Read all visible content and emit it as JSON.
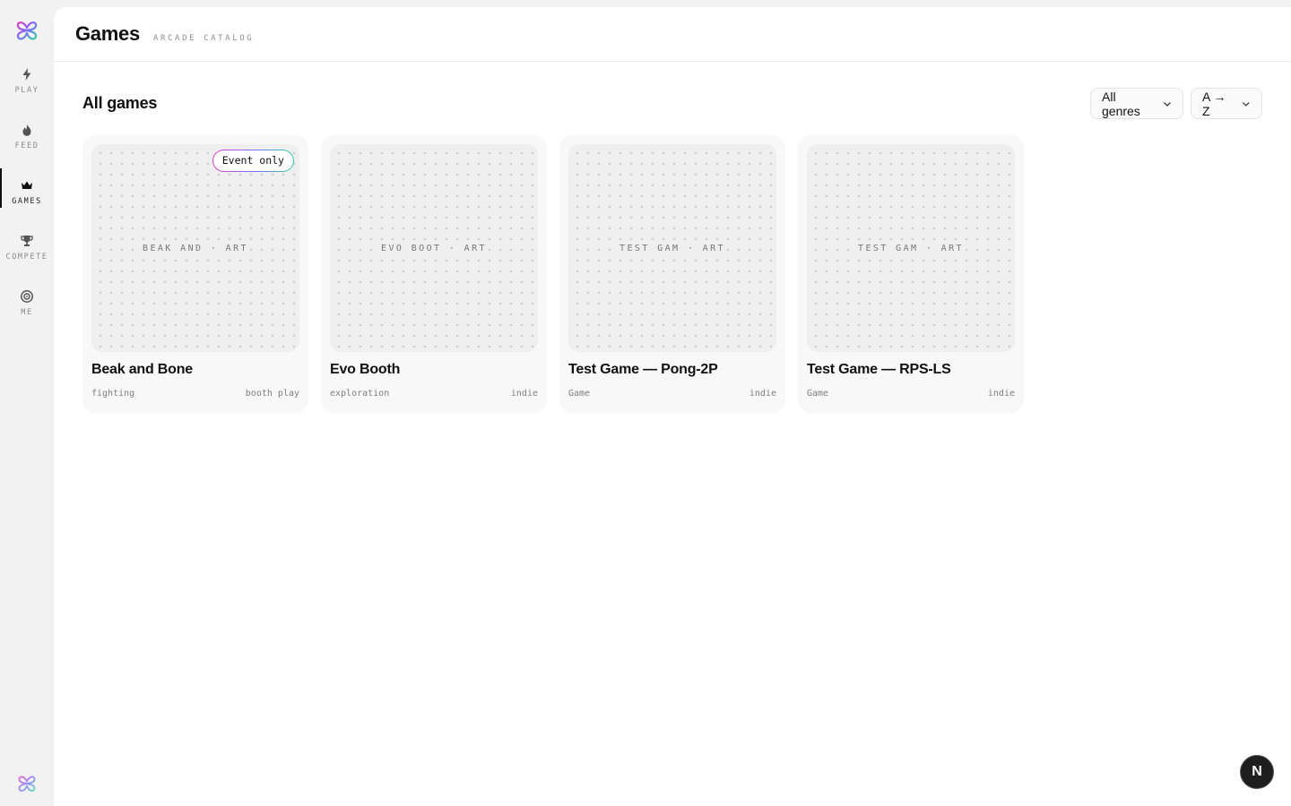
{
  "app": {
    "logo_icon": "gradient-knot-logo-icon",
    "brand_colors": [
      "#e040c0",
      "#7b6cff",
      "#2fd6a0"
    ]
  },
  "sidebar": {
    "items": [
      {
        "label": "PLAY",
        "icon": "lightning-icon",
        "active": false
      },
      {
        "label": "FEED",
        "icon": "flame-icon",
        "active": false
      },
      {
        "label": "GAMES",
        "icon": "crown-icon",
        "active": true
      },
      {
        "label": "COMPETE",
        "icon": "trophy-icon",
        "active": false
      },
      {
        "label": "ME",
        "icon": "target-icon",
        "active": false
      }
    ]
  },
  "header": {
    "title": "Games",
    "subtitle": "ARCADE CATALOG"
  },
  "section": {
    "title": "All games"
  },
  "filters": {
    "genre": "All genres",
    "sort": "A → Z"
  },
  "games": [
    {
      "title": "Beak and Bone",
      "art_label": "BEAK AND · ART",
      "genre": "fighting",
      "tag": "booth play",
      "badge": "Event only"
    },
    {
      "title": "Evo Booth",
      "art_label": "EVO BOOT · ART",
      "genre": "exploration",
      "tag": "indie"
    },
    {
      "title": "Test Game — Pong-2P",
      "art_label": "TEST GAM · ART",
      "genre": "Game",
      "tag": "indie"
    },
    {
      "title": "Test Game — RPS-LS",
      "art_label": "TEST GAM · ART",
      "genre": "Game",
      "tag": "indie"
    }
  ],
  "fab": {
    "label": "N"
  }
}
